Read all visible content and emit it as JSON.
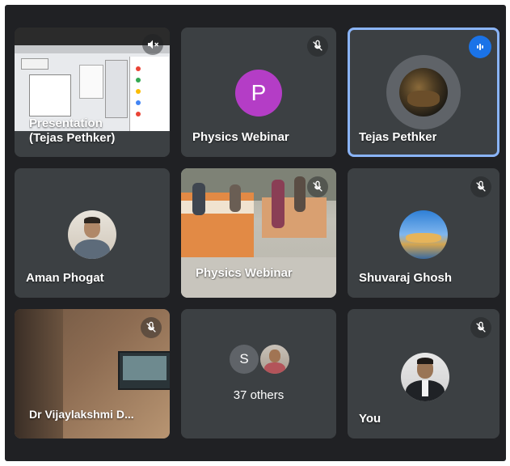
{
  "tiles": {
    "presentation": {
      "name": "Presentation\n(Tejas Pethker)",
      "muted": true
    },
    "physics_webinar_1": {
      "name": "Physics Webinar",
      "avatar_letter": "P",
      "avatar_color": "#b43dc6",
      "muted": true
    },
    "tejas": {
      "name": "Tejas Pethker",
      "speaking": true
    },
    "aman": {
      "name": "Aman Phogat"
    },
    "physics_webinar_2": {
      "name": "Physics Webinar",
      "muted": true
    },
    "shuvaraj": {
      "name": "Shuvaraj Ghosh",
      "muted": true
    },
    "vijaylakshmi": {
      "name": "Dr Vijaylakshmi D...",
      "muted": true
    },
    "others": {
      "label": "37 others",
      "avatar_letter": "S"
    },
    "you": {
      "name": "You",
      "muted": true
    }
  },
  "colors": {
    "tile_bg": "#3c4043",
    "stage_bg": "#202124",
    "speaking_border": "#8ab4f8",
    "speaking_badge": "#1a73e8"
  }
}
